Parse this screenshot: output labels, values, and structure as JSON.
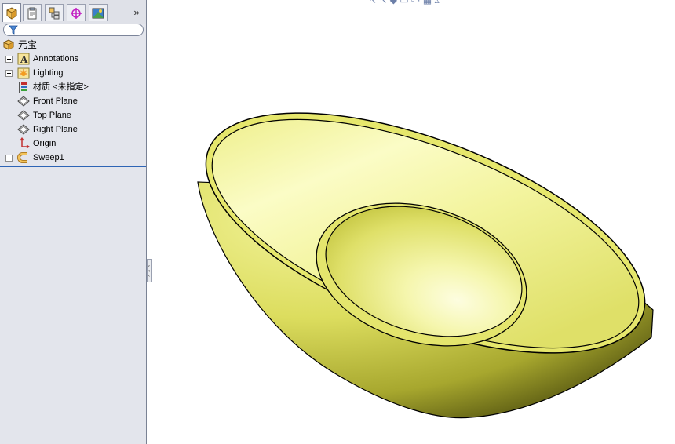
{
  "panel": {
    "tabs": [
      {
        "name": "feature-manager-tab",
        "icon": "part-icon",
        "active": true
      },
      {
        "name": "property-manager-tab",
        "icon": "property-icon",
        "active": false
      },
      {
        "name": "configuration-manager-tab",
        "icon": "configuration-icon",
        "active": false
      },
      {
        "name": "dimxpert-manager-tab",
        "icon": "crosshair-icon",
        "active": false
      },
      {
        "name": "display-manager-tab",
        "icon": "display-icon",
        "active": false
      }
    ],
    "more_label": "»"
  },
  "tree": {
    "root": {
      "label": "元宝",
      "icon": "part-icon"
    },
    "items": [
      {
        "label": "Annotations",
        "icon": "annotations-icon",
        "expandable": true
      },
      {
        "label": "Lighting",
        "icon": "lighting-icon",
        "expandable": true
      },
      {
        "label": "材质 <未指定>",
        "icon": "material-icon",
        "expandable": false
      },
      {
        "label": "Front Plane",
        "icon": "plane-icon",
        "expandable": false
      },
      {
        "label": "Top Plane",
        "icon": "plane-icon",
        "expandable": false
      },
      {
        "label": "Right Plane",
        "icon": "plane-icon",
        "expandable": false
      },
      {
        "label": "Origin",
        "icon": "origin-icon",
        "expandable": false
      },
      {
        "label": "Sweep1",
        "icon": "sweep-icon",
        "expandable": true
      }
    ]
  },
  "colors": {
    "panel_bg": "#e3e5ec",
    "model_light": "#fbfcc4",
    "model_base": "#e2e36a",
    "model_dark": "#5a5a10",
    "edge": "#000000",
    "tree_end_line": "#2e64b5"
  }
}
